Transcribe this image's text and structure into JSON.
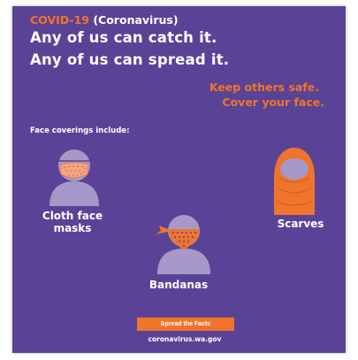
{
  "header": {
    "title_accent": "COVID-19",
    "title_rest": " (Coronavirus)",
    "headline_1": "Any of us can catch it.",
    "headline_2": "Any of us can spread it.",
    "tagline_1": "Keep others safe.",
    "tagline_2": "Cover your face."
  },
  "coverings": {
    "intro": "Face coverings include:",
    "items": [
      {
        "label_line1": "Cloth face",
        "label_line2": "masks",
        "icon": "cloth-mask-person-icon"
      },
      {
        "label": "Bandanas",
        "icon": "bandana-person-icon"
      },
      {
        "label": "Scarves",
        "icon": "scarf-person-icon"
      }
    ]
  },
  "footer": {
    "button_label": "Spread the Facts",
    "url": "coronavirus.wa.gov"
  },
  "colors": {
    "background": "#5a4396",
    "accent": "#f0742b",
    "figure": "#a699c9",
    "text": "#ffffff"
  }
}
